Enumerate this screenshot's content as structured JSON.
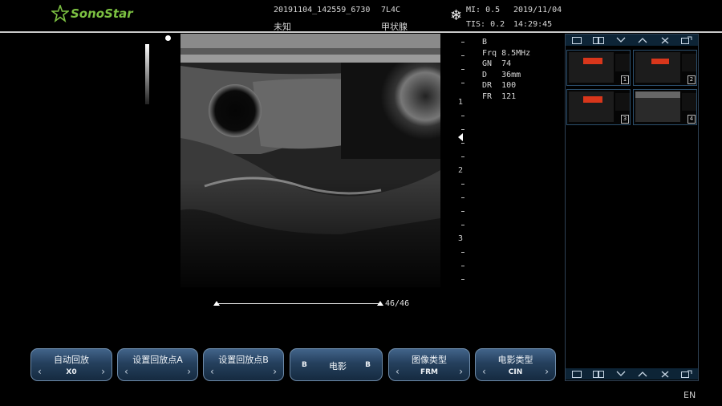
{
  "header": {
    "brand": "SonoStar",
    "study_id": "20191104_142559_6730",
    "probe": "7L4C",
    "patient_name": "未知",
    "exam_type": "甲状腺",
    "mi": "MI: 0.5",
    "tis": "TIS: 0.2",
    "date": "2019/11/04",
    "time": "14:29:45"
  },
  "params": {
    "mode": "B",
    "rows": [
      "Frq 8.5MHz",
      "GN  74",
      "D   36mm",
      "DR  100",
      "FR  121"
    ]
  },
  "depth_scale": {
    "labels": [
      "1",
      "2",
      "3"
    ]
  },
  "cine": {
    "frame_counter": "46/46",
    "frame_fraction": 1.0
  },
  "panel": {
    "toolbar_icons": [
      "single-layout-icon",
      "dual-layout-icon",
      "chevron-down-icon",
      "chevron-up-icon",
      "close-icon",
      "export-icon"
    ],
    "thumbnails": [
      "1",
      "2",
      "3",
      "4"
    ]
  },
  "buttons": [
    {
      "label": "自动回放",
      "value": "X0"
    },
    {
      "label": "设置回放点A",
      "value": ""
    },
    {
      "label": "设置回放点B",
      "value": ""
    },
    {
      "label": "图像类型",
      "value": "FRM"
    },
    {
      "label": "电影类型",
      "value": "CIN"
    }
  ],
  "cine_control": {
    "label": "电影",
    "left": "B",
    "right": "B"
  },
  "language": "EN",
  "colors": {
    "brand": "#7cc142",
    "button_top": "#42648a",
    "panel_border": "#2f4255"
  }
}
